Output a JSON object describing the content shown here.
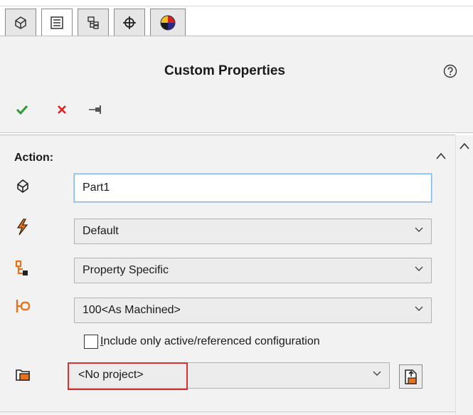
{
  "tabs": [
    {
      "icon": "part-icon",
      "active": false
    },
    {
      "icon": "property-list-icon",
      "active": true
    },
    {
      "icon": "configuration-manager-icon",
      "active": false
    },
    {
      "icon": "crosshair-icon",
      "active": false
    },
    {
      "icon": "appearance-sphere-icon",
      "active": false
    }
  ],
  "header": {
    "title": "Custom Properties",
    "help_icon": "question-circle-icon",
    "actions": [
      {
        "name": "confirm",
        "icon": "checkmark-icon",
        "color": "#2e9b2e"
      },
      {
        "name": "cancel",
        "icon": "close-x-icon",
        "color": "#e02020"
      },
      {
        "name": "pin",
        "icon": "pushpin-icon",
        "color": "#555555"
      }
    ]
  },
  "section": {
    "title": "Action:",
    "name_field": {
      "value": "Part1",
      "icon": "part-outline-icon"
    },
    "material_select": {
      "value": "Default",
      "icon": "lightning-bolt-icon"
    },
    "scope_select": {
      "value": "Property Specific",
      "icon": "config-tree-icon"
    },
    "config_select": {
      "value": "100<As Machined>",
      "icon": "config-branch-icon"
    },
    "include_checkbox": {
      "checked": false,
      "label_hotkey": "I",
      "label_rest": "nclude only active/referenced configuration"
    },
    "project_select": {
      "value": "<No project>",
      "icon": "project-folder-icon"
    },
    "project_button_icon": "open-project-icon"
  },
  "colors": {
    "accent_orange": "#e8731e",
    "highlight_red": "#d83030",
    "panel_bg": "#f2f2f2"
  }
}
